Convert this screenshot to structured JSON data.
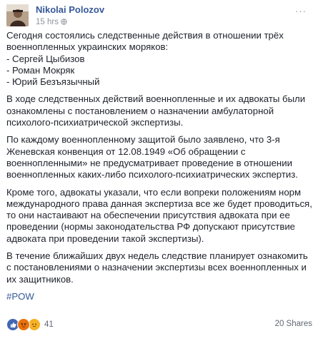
{
  "post": {
    "author": "Nikolai Polozov",
    "time": "15 hrs",
    "menu_label": "···",
    "paragraphs": [
      [
        "Сегодня состоялись следственные действия в отношении трёх военнопленных украинских моряков:",
        "- Сергей Цыбизов",
        "- Роман Мокряк",
        "- Юрий Безъязычный"
      ],
      [
        "В ходе следственных действий военнопленные и их адвокаты были ознакомлены с постановлением о назначении амбулаторной психолого-психиатрической экспертизы."
      ],
      [
        "По каждому военнопленному защитой было заявлено, что 3-я Женевская конвенция от 12.08.1949 «Об обращении с военнопленными» не предусматривает проведение в отношении военнопленных каких-либо психолого-психиатрических экспертиз."
      ],
      [
        "Кроме того, адвокаты указали, что если вопреки положениям норм международного права данная экспертиза все же будет проводиться, то они настаивают на обеспечении присутствия адвоката при ее проведении (нормы законодательства РФ допускают присутствие адвоката при проведении такой экспертизы)."
      ],
      [
        "В течение ближайших двух недель следствие планирует ознакомить с постановлениями о назначении экспертизы всех военнопленных и их защитников."
      ]
    ],
    "hashtag": "#POW"
  },
  "footer": {
    "reactions": [
      "like-icon",
      "angry-icon",
      "sad-icon"
    ],
    "reaction_count": "41",
    "shares": "20 Shares"
  }
}
